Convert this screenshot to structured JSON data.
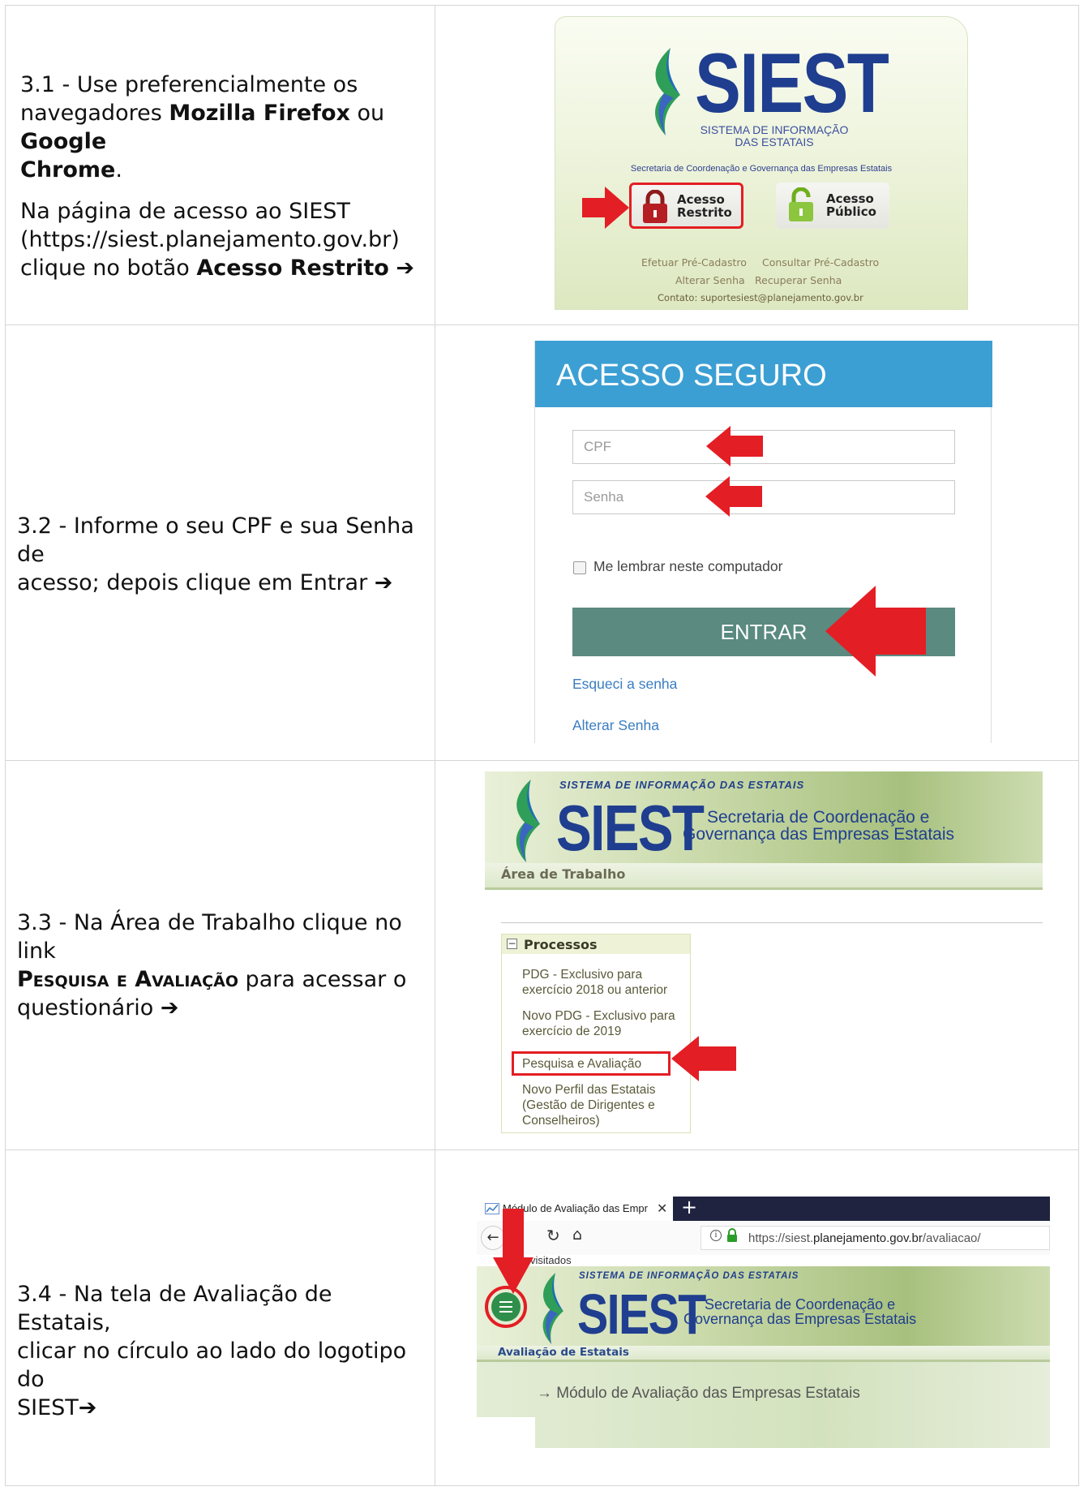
{
  "steps": [
    {
      "l1": "3.1 - Use preferencialmente os",
      "l2a": "navegadores ",
      "l2b": "Mozilla Firefox",
      "l2c": " ou ",
      "l2d": "Google",
      "l3a": "Chrome",
      "l3b": ".",
      "p2l1": "Na página de acesso ao SIEST",
      "p2l2": "(https://siest.planejamento.gov.br)",
      "p2l3a": "clique no botão ",
      "p2l3b": "Acesso Restrito",
      "arrow": "➔"
    },
    {
      "l1": "3.2 - Informe o seu CPF e sua Senha de",
      "l2": "acesso; depois clique em Entrar ",
      "arrow": "➔"
    },
    {
      "l1": "3.3 - Na Área de Trabalho clique no link",
      "l2a": "Pesquisa e Avaliação",
      "l2b": " para acessar o",
      "l3": "questionário ",
      "arrow": "➔"
    },
    {
      "l1": "3.4 - Na tela de Avaliação de Estatais,",
      "l2": "clicar no círculo ao lado do logotipo do",
      "l3": "SIEST",
      "arrow": "➔"
    }
  ],
  "panel1": {
    "logo": "SIEST",
    "subtitle1": "SISTEMA DE INFORMAÇÃO",
    "subtitle2": "DAS ESTATAIS",
    "secretaria": "Secretaria de Coordenação e Governança das Empresas Estatais",
    "btn_restrito_1": "Acesso",
    "btn_restrito_2": "Restrito",
    "btn_publico_1": "Acesso",
    "btn_publico_2": "Público",
    "link_precadastro": "Efetuar Pré-Cadastro",
    "link_consultar": "Consultar Pré-Cadastro",
    "link_alterar": "Alterar Senha",
    "link_recuperar": "Recuperar Senha",
    "contato": "Contato: suportesiest@planejamento.gov.br"
  },
  "panel2": {
    "title": "ACESSO SEGURO",
    "cpf_placeholder": "CPF",
    "senha_placeholder": "Senha",
    "remember": "Me lembrar neste computador",
    "entrar": "ENTRAR",
    "forgot": "Esqueci a senha",
    "change": "Alterar Senha"
  },
  "panel3": {
    "sistema": "SISTEMA DE INFORMAÇÃO DAS ESTATAIS",
    "logo": "SIEST",
    "sec1": "Secretaria de Coordenação e",
    "sec2": "Governança das Empresas Estatais",
    "area": "Área de Trabalho",
    "processos": "Processos",
    "item1a": "PDG - Exclusivo para",
    "item1b": "exercício 2018 ou anterior",
    "item2a": "Novo PDG - Exclusivo para",
    "item2b": "exercício de 2019",
    "item3": "Pesquisa e Avaliação",
    "item4a": "Novo Perfil das Estatais",
    "item4b": "(Gestão de Dirigentes e",
    "item4c": "Conselheiros)"
  },
  "panel4": {
    "tab": "Módulo de Avaliação das Empr",
    "url_pre": "https://siest.",
    "url_host": "planejamento.gov.br",
    "url_post": "/avaliacao/",
    "bookmark": "visitados",
    "sistema": "SISTEMA DE INFORMAÇÃO DAS ESTATAIS",
    "logo": "SIEST",
    "sec1": "Secretaria de Coordenação e",
    "sec2": "Governança das Empresas Estatais",
    "area": "Avaliação de Estatais",
    "breadcrumb": "→ Módulo de Avaliação das Empresas Estatais"
  },
  "colors": {
    "red": "#e31e24",
    "siestBlue": "#1f3e8f",
    "headerBlue": "#3c9fd3",
    "entrar": "#5a8a80"
  }
}
